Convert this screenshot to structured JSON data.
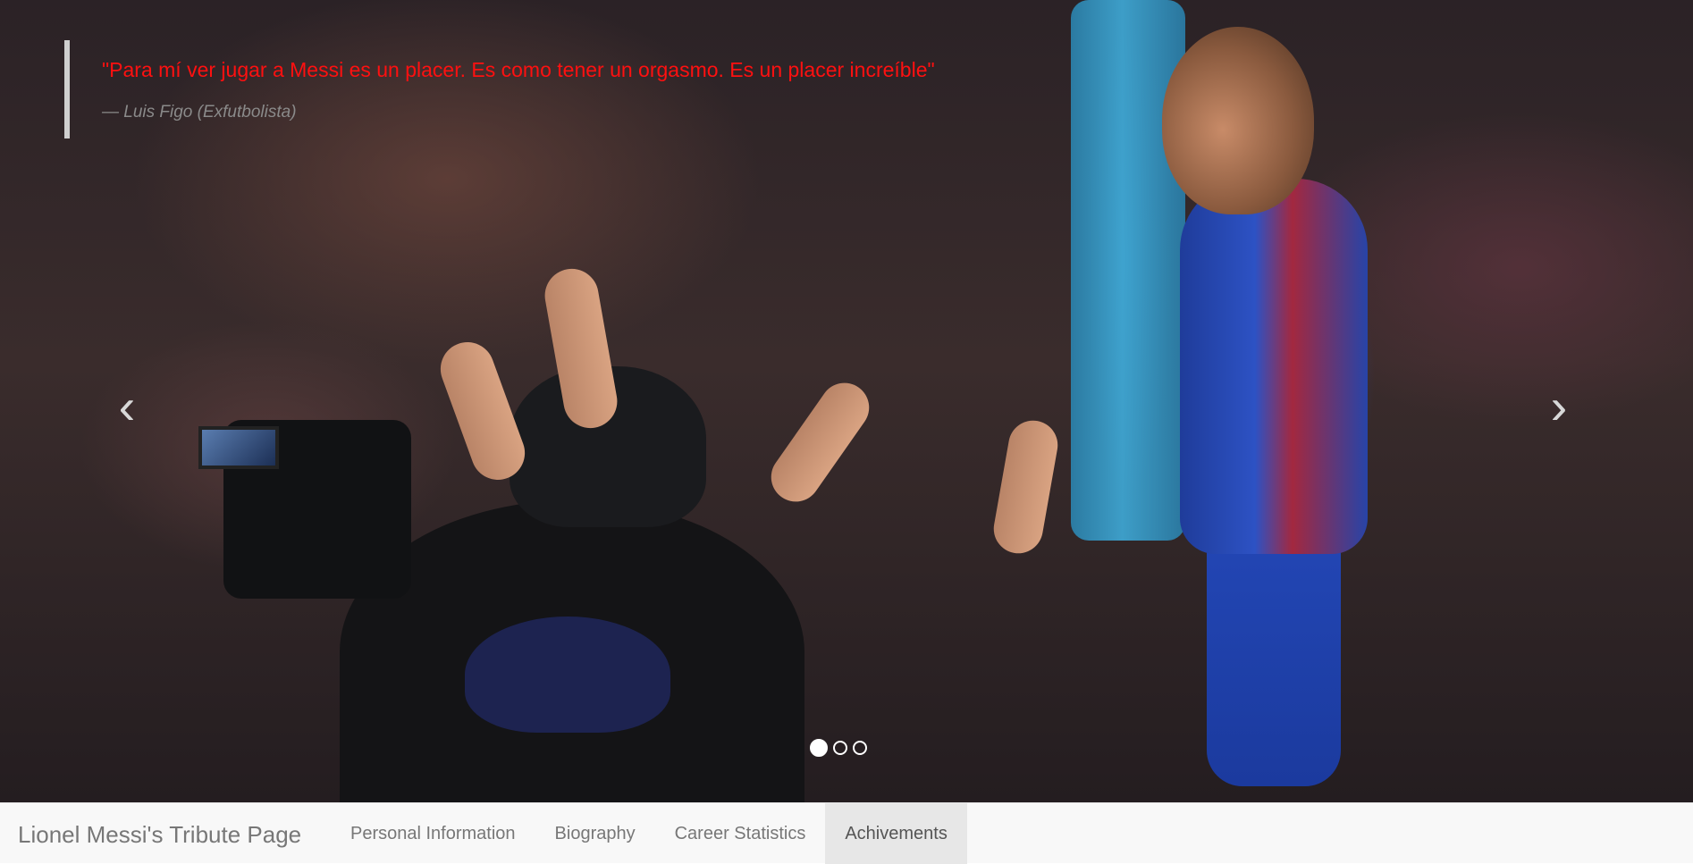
{
  "carousel": {
    "quote": {
      "text": "\"Para mí ver jugar a Messi es un placer. Es como tener un orgasmo. Es un placer increíble\"",
      "author": "— Luis Figo (Exfutbolista)"
    },
    "prev_glyph": "‹",
    "next_glyph": "›",
    "indicators": [
      {
        "active": true
      },
      {
        "active": false
      },
      {
        "active": false
      }
    ],
    "image_description_icon": "photo-messi-celebration"
  },
  "navbar": {
    "brand": "Lionel Messi's Tribute Page",
    "items": [
      {
        "label": "Personal Information",
        "active": false
      },
      {
        "label": "Biography",
        "active": false
      },
      {
        "label": "Career Statistics",
        "active": false
      },
      {
        "label": "Achivements",
        "active": true
      }
    ]
  },
  "colors": {
    "quote_text": "#ff1010",
    "quote_author": "#8a8a8a",
    "navbar_bg": "#f8f8f8",
    "navbar_active_bg": "#e7e7e7",
    "nav_text": "#777777"
  }
}
